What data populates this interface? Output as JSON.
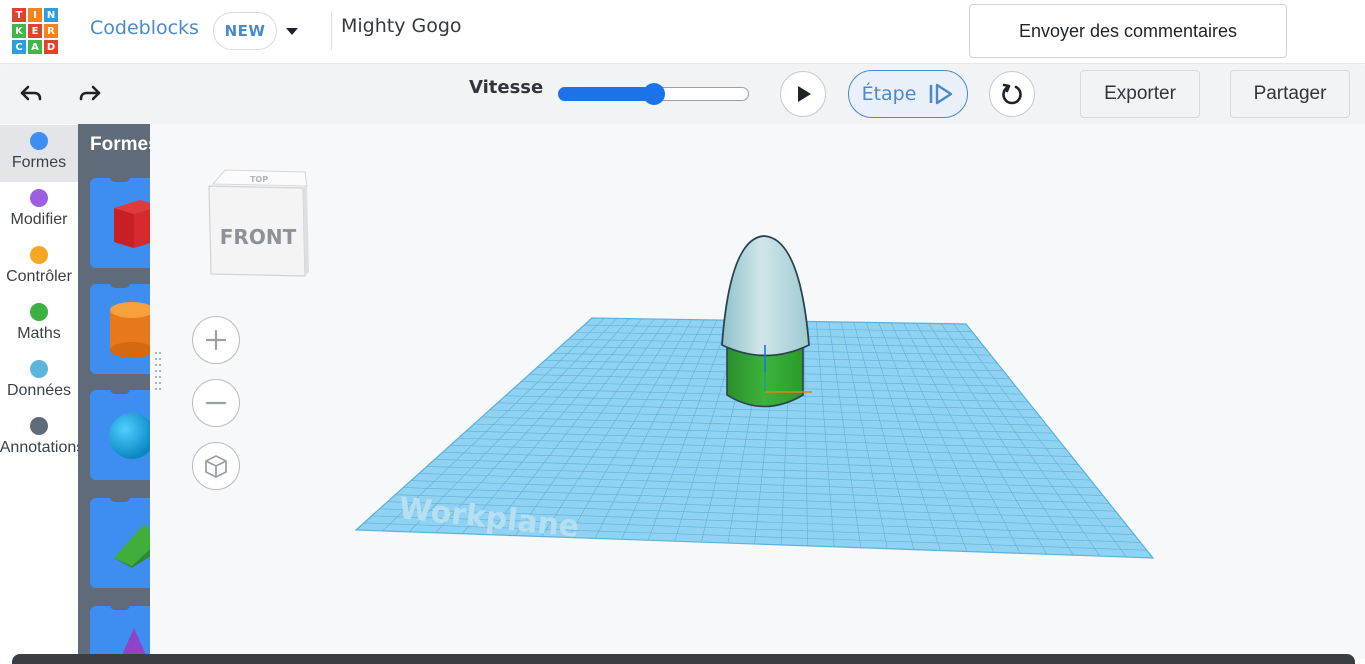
{
  "header": {
    "logo_letters": [
      "T",
      "I",
      "N",
      "K",
      "E",
      "R",
      "C",
      "A",
      "D"
    ],
    "logo_colors": [
      "#e2422b",
      "#f58220",
      "#2c9fd9",
      "#43b649",
      "#e2422b",
      "#f58220",
      "#2c9fd9",
      "#43b649",
      "#e2422b"
    ],
    "app_name": "Codeblocks",
    "new_badge": "NEW",
    "project_name": "Mighty Gogo",
    "feedback_button": "Envoyer des commentaires"
  },
  "toolbar": {
    "undo_icon": "undo-arrow-icon",
    "redo_icon": "redo-arrow-icon",
    "speed_label": "Vitesse",
    "speed_value": 0.5,
    "play_icon": "play-icon",
    "step_label": "Étape",
    "step_icon": "step-forward-icon",
    "reset_icon": "reset-icon",
    "export_label": "Exporter",
    "share_label": "Partager",
    "accent_color": "#1a73e8"
  },
  "categories": [
    {
      "label": "Formes",
      "color": "#3d8ef0",
      "active": true
    },
    {
      "label": "Modifier",
      "color": "#9d5fe0"
    },
    {
      "label": "Contrôler",
      "color": "#f5a623"
    },
    {
      "label": "Maths",
      "color": "#3cb043"
    },
    {
      "label": "Données",
      "color": "#5bb5dc"
    },
    {
      "label": "Annotations",
      "color": "#5f6b78"
    }
  ],
  "flyout": {
    "title": "Formes",
    "shapes": [
      "box",
      "cylinder",
      "sphere",
      "roof",
      "pyramid"
    ]
  },
  "viewport": {
    "viewcube_front": "FRONT",
    "viewcube_top": "TOP",
    "zoom_in_icon": "plus-icon",
    "zoom_out_icon": "minus-icon",
    "fit_view_icon": "home-cube-icon",
    "workplane_label": "Workplane"
  }
}
